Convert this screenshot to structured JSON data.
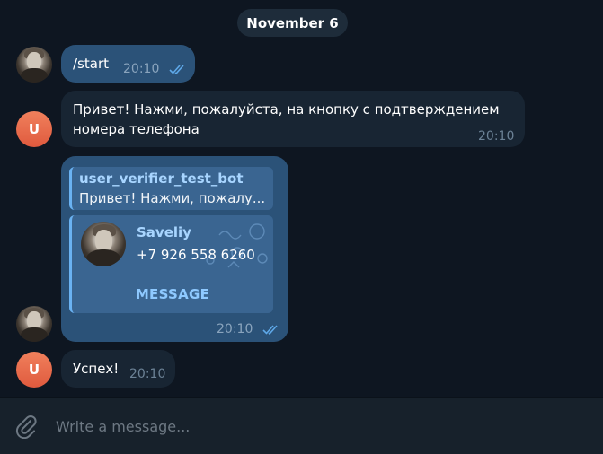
{
  "date_separator": "November 6",
  "messages": [
    {
      "direction": "outgoing",
      "text": "/start",
      "time": "20:10",
      "status": "read"
    },
    {
      "direction": "incoming",
      "sender_initial": "U",
      "text_line1": "Привет! Нажми, пожалуйста, на кнопку с подтверждением",
      "text_line2": "номера телефона",
      "time": "20:10"
    },
    {
      "direction": "outgoing",
      "reply": {
        "author": "user_verifier_test_bot",
        "text": "Привет! Нажми, пожалу..."
      },
      "contact": {
        "name": "Saveliy",
        "phone": "+7 926 558 6260",
        "button_label": "MESSAGE"
      },
      "time": "20:10",
      "status": "read"
    },
    {
      "direction": "incoming",
      "sender_initial": "U",
      "text": "Успех!",
      "time": "20:10"
    }
  ],
  "composer": {
    "placeholder": "Write a message..."
  },
  "colors": {
    "background": "#0e1621",
    "outgoing_bubble": "#2b5278",
    "incoming_bubble": "#182533",
    "accent": "#6ab2f2",
    "avatar_user": "#e8694d"
  },
  "icons": {
    "attach": "paperclip-icon",
    "read_status": "double-check-icon"
  }
}
